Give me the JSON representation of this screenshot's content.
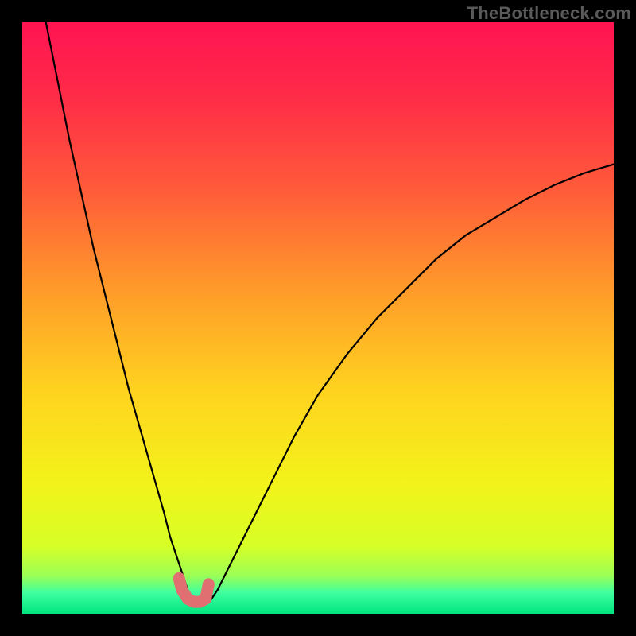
{
  "watermark": "TheBottleneck.com",
  "chart_data": {
    "type": "line",
    "title": "",
    "xlabel": "",
    "ylabel": "",
    "xlim": [
      0,
      100
    ],
    "ylim": [
      0,
      100
    ],
    "grid": false,
    "series": [
      {
        "name": "curve",
        "x": [
          4,
          6,
          8,
          10,
          12,
          14,
          16,
          18,
          20,
          22,
          24,
          25,
          26,
          27,
          28,
          29,
          30,
          31,
          32,
          33,
          35,
          38,
          42,
          46,
          50,
          55,
          60,
          65,
          70,
          75,
          80,
          85,
          90,
          95,
          100
        ],
        "y": [
          100,
          90,
          80,
          71,
          62,
          54,
          46,
          38,
          31,
          24,
          17,
          13,
          10,
          7,
          4,
          2.5,
          2,
          2,
          2.5,
          4,
          8,
          14,
          22,
          30,
          37,
          44,
          50,
          55,
          60,
          64,
          67,
          70,
          72.5,
          74.5,
          76
        ]
      },
      {
        "name": "highlight",
        "x": [
          26.5,
          27,
          28,
          29,
          30,
          31,
          31.5
        ],
        "y": [
          6,
          4,
          2.5,
          2,
          2,
          2.5,
          5
        ]
      }
    ],
    "gradient_stops": [
      {
        "offset": 0.0,
        "color": "#ff1452"
      },
      {
        "offset": 0.12,
        "color": "#ff2a48"
      },
      {
        "offset": 0.28,
        "color": "#ff5a3a"
      },
      {
        "offset": 0.45,
        "color": "#ff9a2a"
      },
      {
        "offset": 0.62,
        "color": "#ffd21f"
      },
      {
        "offset": 0.78,
        "color": "#f3f31a"
      },
      {
        "offset": 0.885,
        "color": "#d7ff26"
      },
      {
        "offset": 0.935,
        "color": "#9dff55"
      },
      {
        "offset": 0.965,
        "color": "#3effa0"
      },
      {
        "offset": 1.0,
        "color": "#00e57f"
      }
    ],
    "colors": {
      "curve": "#000000",
      "highlight": "#e06f72"
    }
  }
}
